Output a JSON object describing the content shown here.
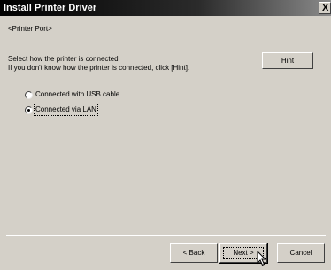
{
  "window": {
    "title": "Install Printer Driver",
    "close_glyph": "X"
  },
  "main": {
    "section_title": "<Printer Port>",
    "instructions": [
      "Select how the printer is connected.",
      "If you don't know how the printer is connected, click [Hint]."
    ],
    "hint_label": "Hint",
    "options": [
      {
        "label": "Connected with USB cable",
        "selected": false
      },
      {
        "label": "Connected via LAN",
        "selected": true
      }
    ]
  },
  "footer": {
    "back_label": "< Back",
    "next_label": "Next >",
    "cancel_label": "Cancel"
  },
  "icons": {
    "close": "close-icon",
    "cursor": "mouse-pointer-icon"
  }
}
